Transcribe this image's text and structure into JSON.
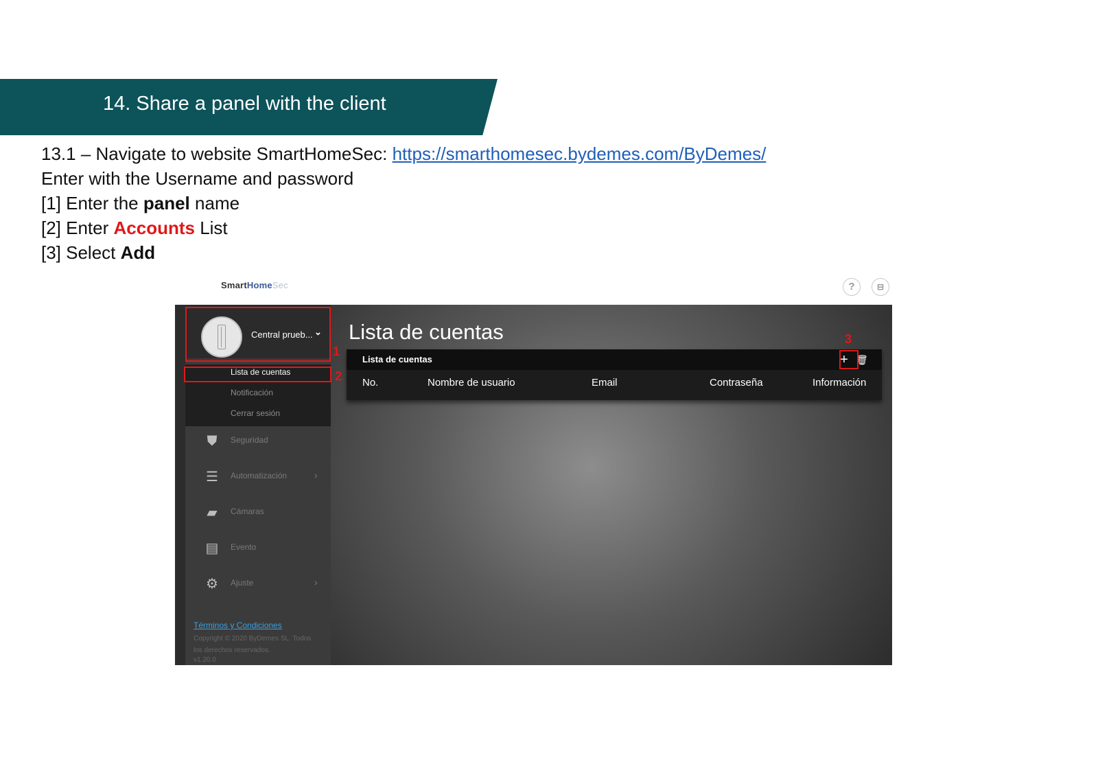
{
  "banner": {
    "title": "14. Share a panel with the client"
  },
  "instructions": {
    "step_prefix": "13.1 – Navigate to website SmartHomeSec: ",
    "url": "https://smarthomesec.bydemes.com/ByDemes/",
    "line2": "Enter with the Username and password",
    "line3_a": "[1] Enter the ",
    "line3_b": "panel",
    "line3_c": " name",
    "line4_a": "[2] Enter ",
    "line4_b": "Accounts",
    "line4_c": " List",
    "line5_a": "[3] Select ",
    "line5_b": "Add"
  },
  "app": {
    "brand": {
      "smart": "Smart",
      "home": "Home",
      "sec": "Sec"
    },
    "top_icons": [
      "help-icon",
      "profile-card-icon"
    ],
    "help_glyph": "?",
    "profile_glyph": "⊟",
    "panel_name": "Central prueb...",
    "chevron_glyph": "⌄",
    "submenu": [
      "Lista de cuentas",
      "Notificación",
      "Cerrar sesión"
    ],
    "nav": [
      {
        "label": "Seguridad",
        "icon": "shield-icon",
        "glyph": "⛊"
      },
      {
        "label": "Automatización",
        "icon": "sliders-icon",
        "glyph": "☰"
      },
      {
        "label": "Cámaras",
        "icon": "camera-icon",
        "glyph": "▰"
      },
      {
        "label": "Evento",
        "icon": "list-icon",
        "glyph": "▤"
      },
      {
        "label": "Ajuste",
        "icon": "gear-icon",
        "glyph": "⚙"
      }
    ],
    "arrow_glyph": "›",
    "footer": {
      "terms": "Términos y Condiciones",
      "copyright": "Copyright © 2020 ByDemes SL. Todos los derechos reservados.",
      "version": "v1.20.0"
    },
    "page_title": "Lista de cuentas",
    "card_title": "Lista de cuentas",
    "add_glyph": "+",
    "trash_glyph": "🗑",
    "columns": [
      "No.",
      "Nombre de usuario",
      "Email",
      "Contraseña",
      "Información"
    ],
    "annotations": [
      "1",
      "2",
      "3"
    ],
    "annotation_color": "#e01818"
  }
}
